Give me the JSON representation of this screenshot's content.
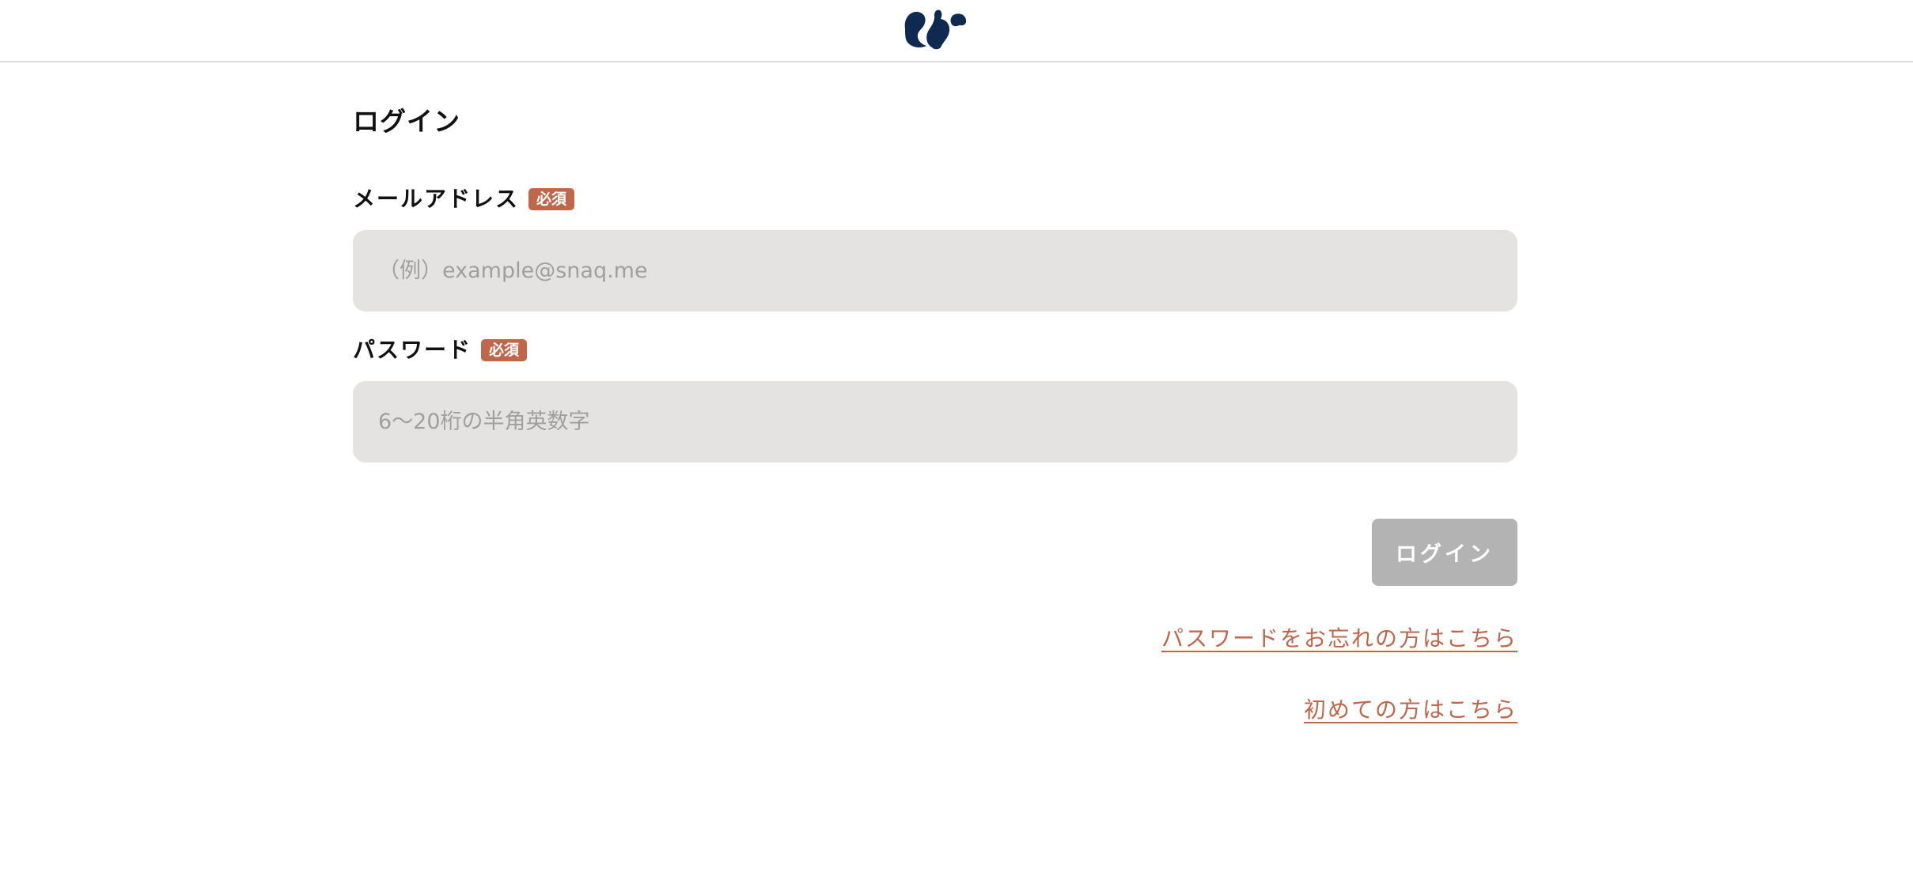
{
  "header": {
    "logo_icon": "squirrel-logo-icon",
    "logo_color": "#0e2a50"
  },
  "login_form": {
    "title": "ログイン",
    "email": {
      "label": "メールアドレス",
      "required_badge": "必須",
      "placeholder": "（例）example@snaq.me",
      "value": ""
    },
    "password": {
      "label": "パスワード",
      "required_badge": "必須",
      "placeholder": "6〜20桁の半角英数字",
      "value": ""
    },
    "submit_label": "ログイン",
    "forgot_password_link": "パスワードをお忘れの方はこちら",
    "first_time_link": "初めての方はこちら"
  },
  "colors": {
    "accent": "#c0664a",
    "input_bg": "#e4e3e1",
    "button_disabled": "#b3b3b3",
    "logo": "#0e2a50"
  }
}
